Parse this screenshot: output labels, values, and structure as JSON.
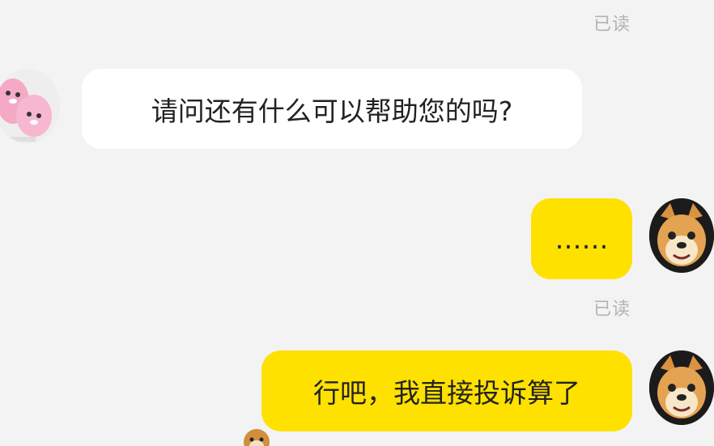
{
  "chat": {
    "messages": [
      {
        "side": "left",
        "text": "请问还有什么可以帮助您的吗?"
      },
      {
        "side": "right",
        "text": "……",
        "status": "已读"
      },
      {
        "side": "right",
        "text": "行吧，我直接投诉算了"
      }
    ],
    "top_status": "已读"
  },
  "colors": {
    "background": "#f3f3f3",
    "incoming_bubble": "#ffffff",
    "outgoing_bubble": "#ffe100",
    "read_status": "#b3b3b3"
  },
  "icons": {
    "incoming_avatar": "pink-plush-avatar",
    "outgoing_avatar": "shiba-dog-avatar"
  }
}
